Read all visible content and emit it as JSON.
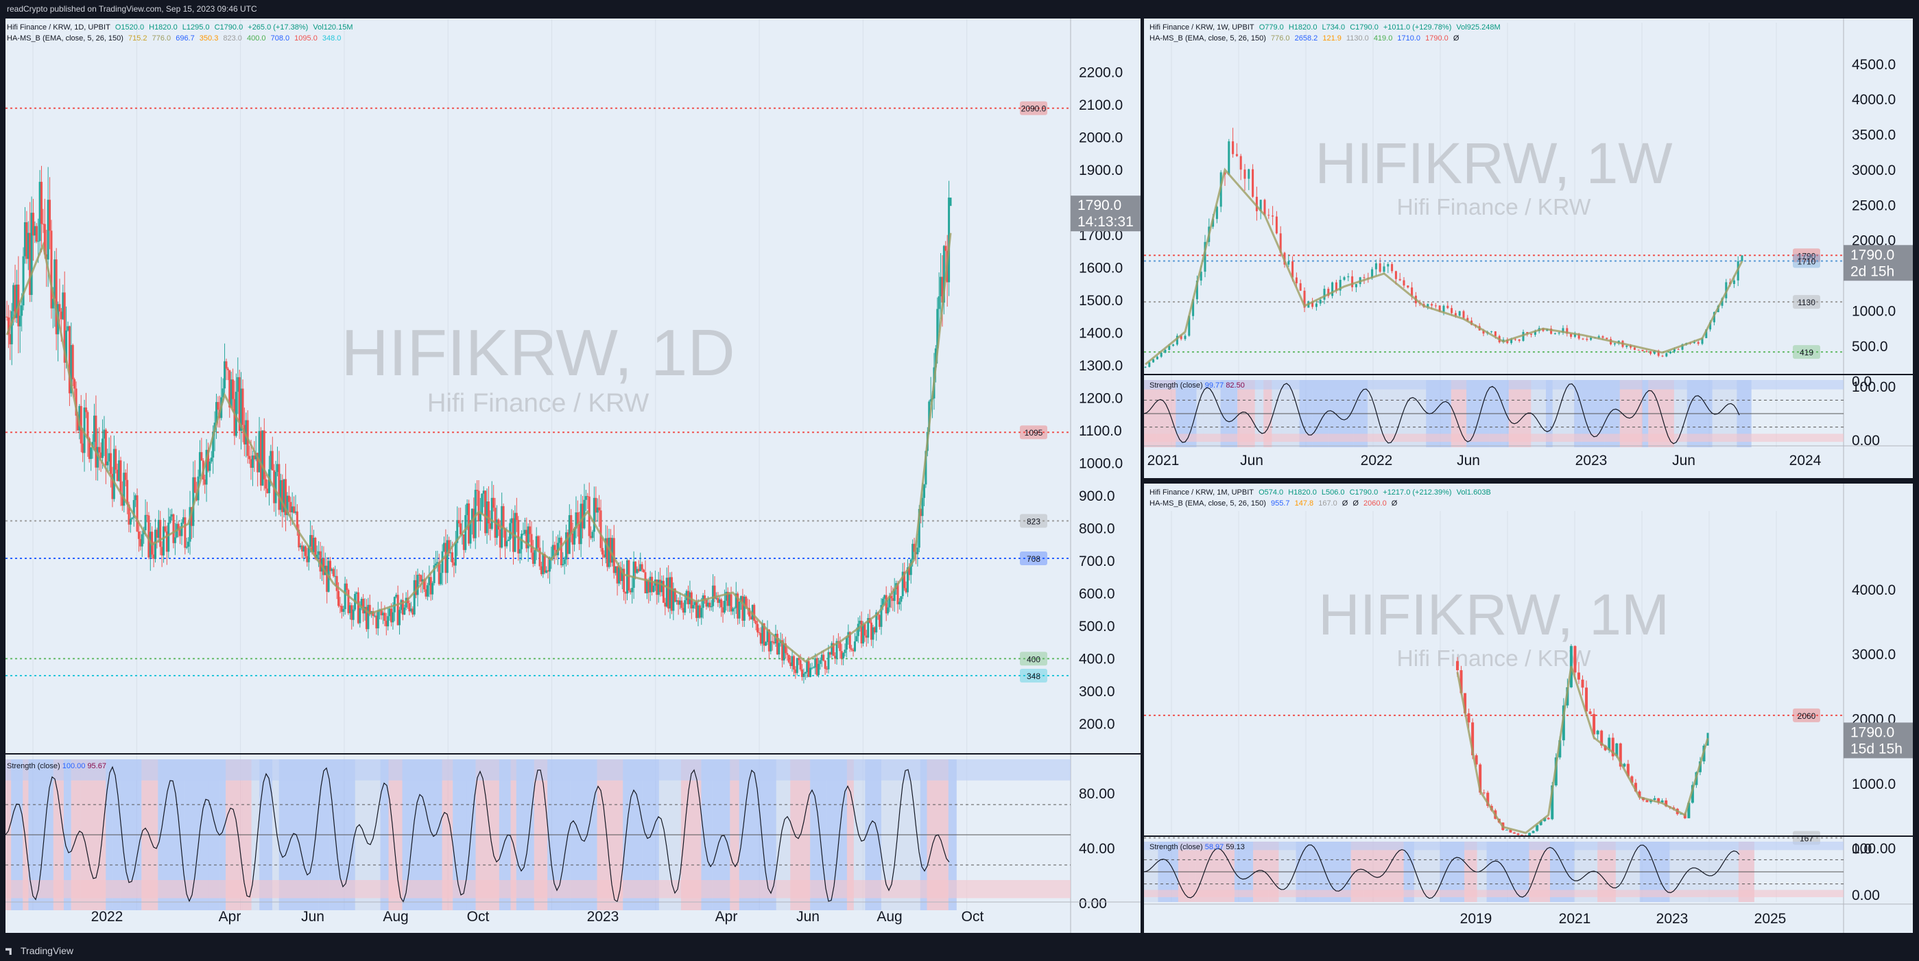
{
  "header": {
    "publish_text": "readCrypto published on TradingView.com, Sep 15, 2023 09:46 UTC"
  },
  "footer": {
    "brand": "TradingView"
  },
  "colors": {
    "up": "#26a69a",
    "down": "#ef5350",
    "ema5": "#e8c547",
    "ema26": "#ef9a9a",
    "ema150": "#9e9d62",
    "blue_line": "#2962ff",
    "orange_line": "#ff9800"
  },
  "panels": {
    "daily": {
      "legend_line1": [
        "Hifi Finance / KRW, 1D, UPBIT",
        "O1520.0",
        "H1820.0",
        "L1295.0",
        "C1790.0",
        "+265.0 (+17.38%)",
        "Vol120.15M"
      ],
      "legend_line2": [
        "HA-MS_B (EMA, close, 5, 26, 150)",
        "715.2",
        "776.0",
        "696.7",
        "350.3",
        "823.0",
        "400.0",
        "708.0",
        "1095.0",
        "348.0"
      ],
      "watermark_symbol": "HIFIKRW, 1D",
      "watermark_name": "Hifi Finance / KRW",
      "price_tag_value": "1790.0",
      "price_tag_timer": "14:13:31",
      "strength_legend": [
        "Strength (close)",
        "100.00",
        "95.67"
      ]
    },
    "weekly": {
      "legend_line1": [
        "Hifi Finance / KRW, 1W, UPBIT",
        "O779.0",
        "H1820.0",
        "L734.0",
        "C1790.0",
        "+1011.0 (+129.78%)",
        "Vol925.248M"
      ],
      "legend_line2": [
        "HA-MS_B (EMA, close, 5, 26, 150)",
        "776.0",
        "2658.2",
        "121.9",
        "1130.0",
        "419.0",
        "1710.0",
        "1790.0",
        "Ø"
      ],
      "watermark_symbol": "HIFIKRW, 1W",
      "watermark_name": "Hifi Finance / KRW",
      "price_tag_value": "1790.0",
      "price_tag_timer": "2d 15h",
      "strength_legend": [
        "Strength (close)",
        "99.77",
        "82.50"
      ]
    },
    "monthly": {
      "legend_line1": [
        "Hifi Finance / KRW, 1M, UPBIT",
        "O574.0",
        "H1820.0",
        "L506.0",
        "C1790.0",
        "+1217.0 (+212.39%)",
        "Vol1.603B"
      ],
      "legend_line2": [
        "HA-MS_B (EMA, close, 5, 26, 150)",
        "955.7",
        "147.8",
        "167.0",
        "Ø",
        "Ø",
        "2060.0",
        "Ø"
      ],
      "watermark_symbol": "HIFIKRW, 1M",
      "watermark_name": "Hifi Finance / KRW",
      "price_tag_value": "1790.0",
      "price_tag_timer": "15d 15h",
      "strength_legend": [
        "Strength (close)",
        "58.97",
        "59.13"
      ]
    }
  },
  "chart_data": [
    {
      "type": "candlestick",
      "title": "Hifi Finance / KRW, 1D, UPBIT",
      "ylim": [
        150,
        2300
      ],
      "y_ticks": [
        "2200.0",
        "2100.0",
        "2000.0",
        "1900.0",
        "1800.0",
        "1700.0",
        "1600.0",
        "1500.0",
        "1400.0",
        "1300.0",
        "1200.0",
        "1100.0",
        "1000.0",
        "900.0",
        "800.0",
        "700.0",
        "600.0",
        "500.0",
        "400.0",
        "300.0",
        "200.0"
      ],
      "x_ticks": [
        "2022",
        "Apr",
        "Jun",
        "Aug",
        "Oct",
        "2023",
        "Apr",
        "Jun",
        "Aug",
        "Oct"
      ],
      "horizontal_levels": [
        {
          "label": "2090.0",
          "value": 2090,
          "color": "#ef5350"
        },
        {
          "label": "1095",
          "value": 1095,
          "color": "#ef5350"
        },
        {
          "label": "823",
          "value": 823,
          "color": "#9e9e9e"
        },
        {
          "label": "708",
          "value": 708,
          "color": "#2962ff"
        },
        {
          "label": "400",
          "value": 400,
          "color": "#66bb6a"
        },
        {
          "label": "348",
          "value": 348,
          "color": "#26c6da"
        }
      ],
      "price_path": [
        {
          "x": "2022-01",
          "y": 1450
        },
        {
          "x": "2022-01b",
          "y": 1750
        },
        {
          "x": "2022-02",
          "y": 1150
        },
        {
          "x": "2022-02b",
          "y": 950
        },
        {
          "x": "2022-03",
          "y": 750
        },
        {
          "x": "2022-03b",
          "y": 820
        },
        {
          "x": "2022-04",
          "y": 1250
        },
        {
          "x": "2022-04b",
          "y": 1020
        },
        {
          "x": "2022-05",
          "y": 800
        },
        {
          "x": "2022-05b",
          "y": 620
        },
        {
          "x": "2022-06",
          "y": 520
        },
        {
          "x": "2022-07",
          "y": 560
        },
        {
          "x": "2022-08",
          "y": 700
        },
        {
          "x": "2022-09",
          "y": 860
        },
        {
          "x": "2022-10",
          "y": 780
        },
        {
          "x": "2022-11",
          "y": 700
        },
        {
          "x": "2022-12",
          "y": 860
        },
        {
          "x": "2023-01",
          "y": 650
        },
        {
          "x": "2023-02",
          "y": 620
        },
        {
          "x": "2023-03",
          "y": 560
        },
        {
          "x": "2023-04",
          "y": 590
        },
        {
          "x": "2023-05",
          "y": 460
        },
        {
          "x": "2023-06",
          "y": 360
        },
        {
          "x": "2023-07",
          "y": 430
        },
        {
          "x": "2023-08",
          "y": 520
        },
        {
          "x": "2023-08b",
          "y": 700
        },
        {
          "x": "2023-09",
          "y": 1790
        }
      ],
      "indicator": {
        "name": "Strength (close)",
        "y_ticks": [
          "80.00",
          "40.00",
          "0.00"
        ],
        "ylim": [
          0,
          100
        ]
      }
    },
    {
      "type": "candlestick",
      "title": "Hifi Finance / KRW, 1W, UPBIT",
      "ylim": [
        -300,
        4800
      ],
      "y_ticks": [
        "4500.0",
        "4000.0",
        "3500.0",
        "3000.0",
        "2500.0",
        "2000.0",
        "1500.0",
        "1000.0",
        "500.0",
        "0.0"
      ],
      "x_ticks": [
        "2021",
        "Jun",
        "2022",
        "Jun",
        "2023",
        "Jun",
        "2024"
      ],
      "horizontal_levels": [
        {
          "label": "1790",
          "value": 1790,
          "color": "#ef5350"
        },
        {
          "label": "1710",
          "value": 1710,
          "color": "#5b9bd5"
        },
        {
          "label": "1130",
          "value": 1130,
          "color": "#9e9e9e"
        },
        {
          "label": "419",
          "value": 419,
          "color": "#66bb6a"
        }
      ],
      "price_path": [
        {
          "x": "2021-01",
          "y": 200
        },
        {
          "x": "2021-03",
          "y": 700
        },
        {
          "x": "2021-04",
          "y": 3200
        },
        {
          "x": "2021-05",
          "y": 2500
        },
        {
          "x": "2021-06",
          "y": 1100
        },
        {
          "x": "2021-08",
          "y": 1400
        },
        {
          "x": "2021-11",
          "y": 1600
        },
        {
          "x": "2022-01",
          "y": 1100
        },
        {
          "x": "2022-04",
          "y": 900
        },
        {
          "x": "2022-07",
          "y": 550
        },
        {
          "x": "2022-10",
          "y": 750
        },
        {
          "x": "2023-01",
          "y": 650
        },
        {
          "x": "2023-04",
          "y": 520
        },
        {
          "x": "2023-06",
          "y": 380
        },
        {
          "x": "2023-08",
          "y": 600
        },
        {
          "x": "2023-09",
          "y": 1790
        }
      ],
      "indicator": {
        "name": "Strength (close)",
        "y_ticks": [
          "100.00",
          "0.00"
        ],
        "ylim": [
          0,
          100
        ]
      }
    },
    {
      "type": "candlestick",
      "title": "Hifi Finance / KRW, 1M, UPBIT",
      "ylim": [
        -400,
        4900
      ],
      "y_ticks": [
        "4000.0",
        "3000.0",
        "2000.0",
        "1000.0",
        "0.0"
      ],
      "x_ticks": [
        "2019",
        "2021",
        "2023",
        "2025"
      ],
      "horizontal_levels": [
        {
          "label": "2060",
          "value": 2060,
          "color": "#ef5350"
        },
        {
          "label": "167",
          "value": 167,
          "color": "#9e9e9e"
        }
      ],
      "price_path": [
        {
          "x": "2019-01",
          "y": 2900
        },
        {
          "x": "2019-03",
          "y": 900
        },
        {
          "x": "2019-08",
          "y": 300
        },
        {
          "x": "2020-06",
          "y": 200
        },
        {
          "x": "2021-01",
          "y": 500
        },
        {
          "x": "2021-03",
          "y": 3000
        },
        {
          "x": "2021-05",
          "y": 1800
        },
        {
          "x": "2021-10",
          "y": 1500
        },
        {
          "x": "2022-05",
          "y": 800
        },
        {
          "x": "2022-12",
          "y": 700
        },
        {
          "x": "2023-06",
          "y": 500
        },
        {
          "x": "2023-09",
          "y": 1790
        }
      ],
      "indicator": {
        "name": "Strength (close)",
        "y_ticks": [
          "100.00",
          "0.00"
        ],
        "ylim": [
          0,
          100
        ]
      }
    }
  ]
}
